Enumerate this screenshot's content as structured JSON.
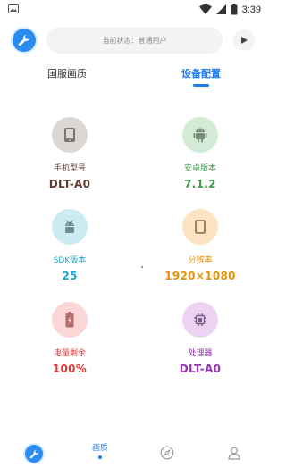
{
  "statusbar": {
    "time": "3:39",
    "battery_label": "3"
  },
  "topbar": {
    "status_text": "当前状态：普通用户"
  },
  "tabs": [
    {
      "label": "国服画质",
      "active": false
    },
    {
      "label": "设备配置",
      "active": true
    }
  ],
  "cards": [
    {
      "label": "手机型号",
      "value": "DLT-A0",
      "icon": "phone-icon",
      "color": "#5a3a2e",
      "bg": "#dcd7d4"
    },
    {
      "label": "安卓版本",
      "value": "7.1.2",
      "icon": "android-icon",
      "color": "#3e9a4a",
      "bg": "#d3ebd4"
    },
    {
      "label": "SDK版本",
      "value": "25",
      "icon": "android-head-icon",
      "color": "#1fa6c6",
      "bg": "#cbeaf2"
    },
    {
      "label": "分辨率",
      "value": "1920×1080",
      "icon": "screen-icon",
      "color": "#e8900c",
      "bg": "#fce3c4"
    },
    {
      "label": "电量剩余",
      "value": "100%",
      "icon": "battery-icon",
      "color": "#e23b3b",
      "bg": "#fad6d6"
    },
    {
      "label": "处理器",
      "value": "DLT-A0",
      "icon": "chip-icon",
      "color": "#9234b0",
      "bg": "#ecd3f1"
    }
  ],
  "bottomnav": [
    {
      "label": "",
      "icon": "wrench-icon"
    },
    {
      "label": "画质",
      "icon": "",
      "active": true
    },
    {
      "label": "",
      "icon": "compass-icon"
    },
    {
      "label": "",
      "icon": "user-icon"
    }
  ],
  "colors": {
    "accent": "#1a7cf0"
  }
}
